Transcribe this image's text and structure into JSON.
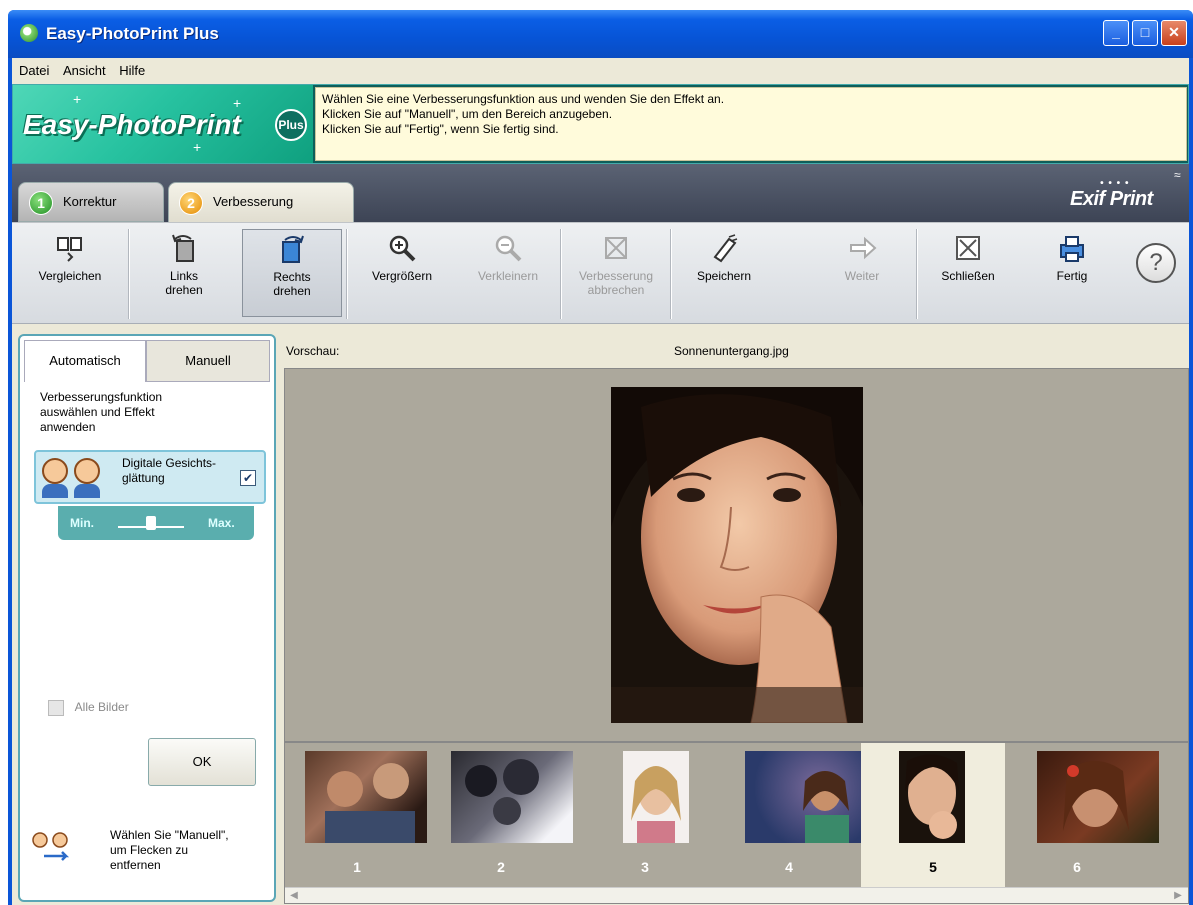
{
  "window": {
    "title": "Easy-PhotoPrint Plus"
  },
  "menu": [
    "Datei",
    "Ansicht",
    "Hilfe"
  ],
  "banner": {
    "logo_text": "Easy-PhotoPrint",
    "logo_badge": "Plus",
    "instructions": [
      "Wählen Sie eine Verbesserungsfunktion aus und wenden Sie den Effekt an.",
      "Klicken Sie auf \"Manuell\", um den Bereich anzugeben.",
      "Klicken Sie auf \"Fertig\", wenn Sie fertig sind."
    ]
  },
  "steps": [
    {
      "num": "1",
      "label": "Korrektur"
    },
    {
      "num": "2",
      "label": "Verbesserung"
    }
  ],
  "exif_logo": "Exif Print",
  "toolbar": {
    "vergleichen": "Vergleichen",
    "links_drehen": [
      "Links",
      "drehen"
    ],
    "rechts_drehen": [
      "Rechts",
      "drehen"
    ],
    "vergroessern": "Vergrößern",
    "verkleinern": "Verkleinern",
    "verbesserung_abbrechen": [
      "Verbesserung",
      "abbrechen"
    ],
    "speichern": "Speichern",
    "weiter": "Weiter",
    "schliessen": "Schließen",
    "fertig": "Fertig",
    "help": "?"
  },
  "left_panel": {
    "tab_auto": "Automatisch",
    "tab_manual": "Manuell",
    "description": [
      "Verbesserungsfunktion",
      "auswählen und Effekt",
      "anwenden"
    ],
    "feature_label": [
      "Digitale Gesichts-",
      "glättung"
    ],
    "feature_checked": true,
    "slider_min": "Min.",
    "slider_max": "Max.",
    "slider_value": 0.5,
    "alle_bilder": "Alle Bilder",
    "ok": "OK",
    "hint": [
      "Wählen Sie \"Manuell\",",
      "um Flecken zu",
      "entfernen"
    ]
  },
  "preview": {
    "label": "Vorschau:",
    "filename": "Sonnenuntergang.jpg"
  },
  "thumbnails": [
    {
      "num": "1"
    },
    {
      "num": "2"
    },
    {
      "num": "3"
    },
    {
      "num": "4"
    },
    {
      "num": "5",
      "selected": true
    },
    {
      "num": "6"
    }
  ]
}
